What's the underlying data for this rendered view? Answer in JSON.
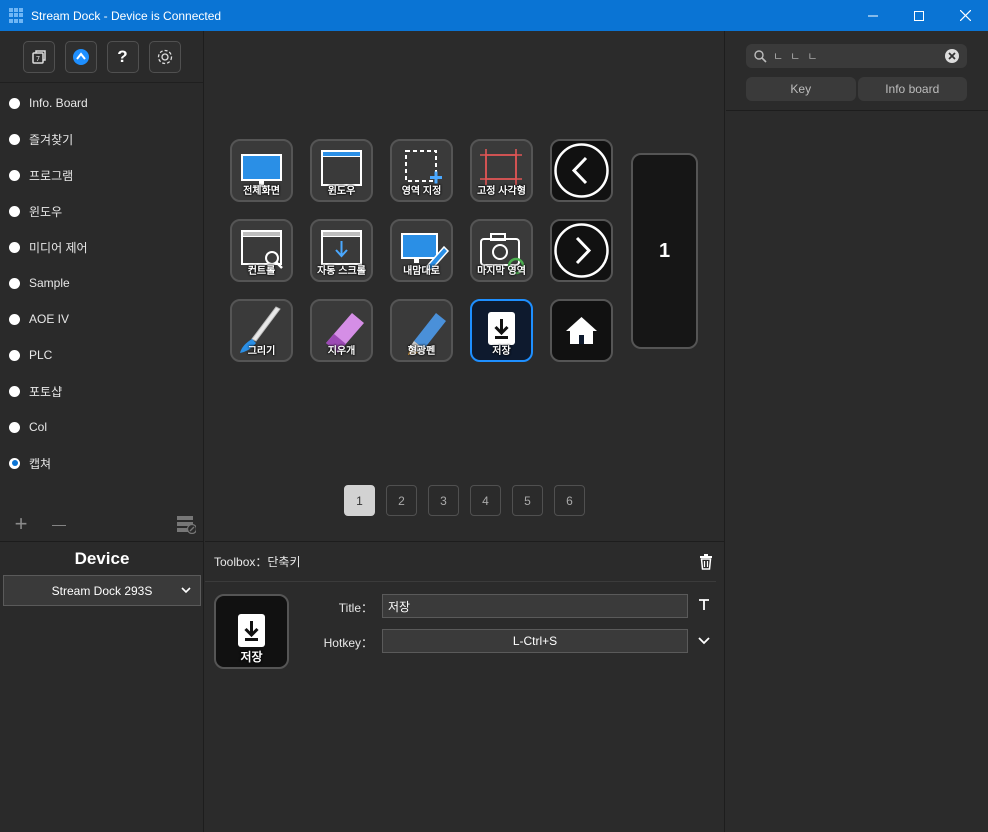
{
  "window": {
    "title": "Stream Dock - Device is Connected",
    "minimize_label": "—",
    "maximize_label": "☐",
    "close_label": "✕"
  },
  "sidebar": {
    "toolbar": [
      {
        "name": "multi-action-icon"
      },
      {
        "name": "store-icon"
      },
      {
        "name": "help-icon",
        "label": "?"
      },
      {
        "name": "settings-icon"
      }
    ],
    "profiles": [
      {
        "label": "Info. Board",
        "selected": false
      },
      {
        "label": "즐겨찾기",
        "selected": false
      },
      {
        "label": "프로그램",
        "selected": false
      },
      {
        "label": "윈도우",
        "selected": false
      },
      {
        "label": "미디어 제어",
        "selected": false
      },
      {
        "label": "Sample",
        "selected": false
      },
      {
        "label": "AOE IV",
        "selected": false
      },
      {
        "label": "PLC",
        "selected": false
      },
      {
        "label": "포토샵",
        "selected": false
      },
      {
        "label": "Col",
        "selected": false
      },
      {
        "label": "캡쳐",
        "selected": true
      }
    ],
    "add_label": "+",
    "remove_label": "—",
    "device_header": "Device",
    "device_selected": "Stream Dock 293S"
  },
  "deck": {
    "keys": [
      {
        "label": "전체화면",
        "icon": "fullscreen-icon"
      },
      {
        "label": "윈도우",
        "icon": "window-icon"
      },
      {
        "label": "영역 지정",
        "icon": "region-select-icon"
      },
      {
        "label": "고정 사각형",
        "icon": "fixed-rect-icon"
      },
      {
        "label": "",
        "icon": "previous-arrow-icon"
      },
      {
        "label": "컨트롤",
        "icon": "control-zoom-icon"
      },
      {
        "label": "자동 스크롤",
        "icon": "auto-scroll-icon"
      },
      {
        "label": "내맘대로",
        "icon": "freeform-icon"
      },
      {
        "label": "마지막 영역",
        "icon": "last-region-icon"
      },
      {
        "label": "",
        "icon": "next-arrow-icon"
      },
      {
        "label": "그리기",
        "icon": "brush-icon"
      },
      {
        "label": "지우개",
        "icon": "eraser-icon"
      },
      {
        "label": "형광펜",
        "icon": "highlighter-icon"
      },
      {
        "label": "저장",
        "icon": "save-icon"
      },
      {
        "label": "",
        "icon": "home-icon"
      }
    ],
    "side_screen_value": "1",
    "pages": [
      "1",
      "2",
      "3",
      "4",
      "5",
      "6"
    ],
    "current_page": "1"
  },
  "properties": {
    "header": "Toolbox：단축키",
    "key_label": "저장",
    "title_label": "Title：",
    "title_value": "저장",
    "hotkey_label": "Hotkey：",
    "hotkey_value": "L-Ctrl+S",
    "text_format_label": "T"
  },
  "right_panel": {
    "search_value": "ㄴ ㄴ ㄴ",
    "tabs": [
      "Key",
      "Info board"
    ]
  },
  "colors": {
    "accent": "#0a74d4",
    "active_border": "#1e8fff"
  }
}
